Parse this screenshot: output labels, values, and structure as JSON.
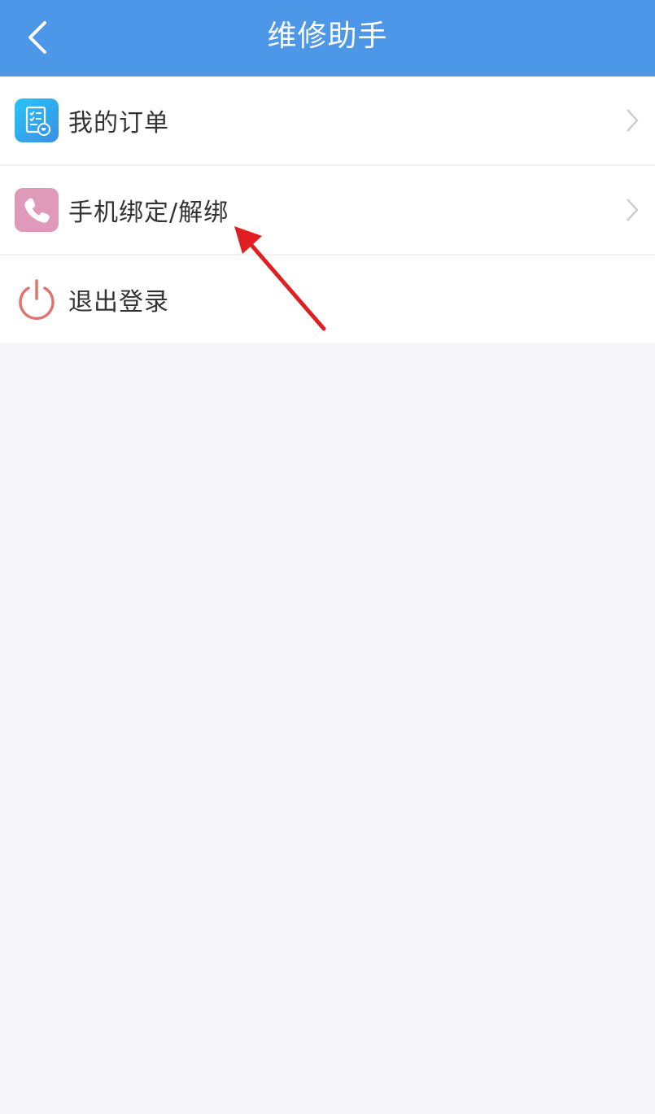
{
  "header": {
    "title": "维修助手",
    "back_icon": "chevron-left-icon",
    "background_color": "#4c97e8"
  },
  "menu": {
    "items": [
      {
        "label": "我的订单",
        "icon": "order-list-icon",
        "icon_color": "#31b8f0",
        "has_chevron": true
      },
      {
        "label": "手机绑定/解绑",
        "icon": "phone-icon",
        "icon_color": "#e09ab9",
        "has_chevron": true
      },
      {
        "label": "退出登录",
        "icon": "power-icon",
        "icon_color": "#e0736d",
        "has_chevron": false
      }
    ]
  },
  "annotation": {
    "icon": "red-arrow-icon",
    "color": "#e02020"
  }
}
